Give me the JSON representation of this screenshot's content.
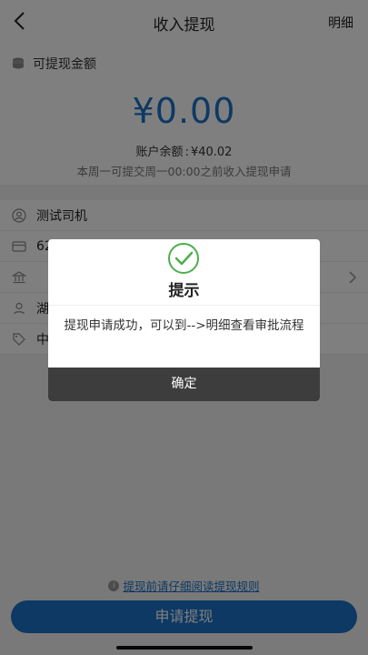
{
  "header": {
    "title": "收入提现",
    "detail_label": "明细"
  },
  "amount_card": {
    "label": "可提现金额",
    "amount": "¥0.00",
    "balance_label": "账户余额",
    "balance_value": "¥40.02",
    "week_note": "本周一可提交周一00:00之前收入提现申请"
  },
  "info_rows": [
    {
      "icon": "user-icon",
      "text": "测试司机"
    },
    {
      "icon": "card-icon",
      "text": "62"
    },
    {
      "icon": "bank-icon",
      "text": ""
    },
    {
      "icon": "location-icon",
      "text": "湖"
    },
    {
      "icon": "tag-icon",
      "text": "中"
    }
  ],
  "footer": {
    "tip": "提现前请仔细阅读提现规则",
    "apply_button": "申请提现"
  },
  "dialog": {
    "title": "提示",
    "message": "提现申请成功，可以到-->明细查看审批流程",
    "ok_button": "确定"
  },
  "colors": {
    "accent": "#1a73c8",
    "dialog_button": "#3d3d3d"
  }
}
